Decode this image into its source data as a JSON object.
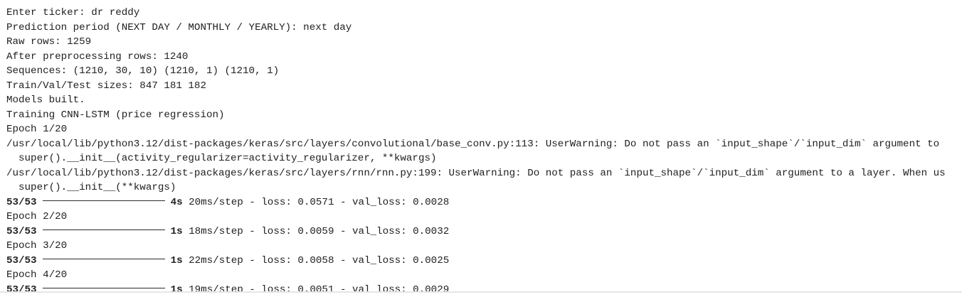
{
  "console": {
    "lines": [
      {
        "text": "Enter ticker: dr reddy"
      },
      {
        "text": "Prediction period (NEXT DAY / MONTHLY / YEARLY): next day"
      },
      {
        "text": "Raw rows: 1259"
      },
      {
        "text": "After preprocessing rows: 1240"
      },
      {
        "text": "Sequences: (1210, 30, 10) (1210, 1) (1210, 1)"
      },
      {
        "text": "Train/Val/Test sizes: 847 181 182"
      },
      {
        "text": "Models built."
      },
      {
        "text": "Training CNN-LSTM (price regression)"
      },
      {
        "text": "Epoch 1/20"
      },
      {
        "text": "/usr/local/lib/python3.12/dist-packages/keras/src/layers/convolutional/base_conv.py:113: UserWarning: Do not pass an `input_shape`/`input_dim` argument to"
      },
      {
        "text": "  super().__init__(activity_regularizer=activity_regularizer, **kwargs)"
      },
      {
        "text": "/usr/local/lib/python3.12/dist-packages/keras/src/layers/rnn/rnn.py:199: UserWarning: Do not pass an `input_shape`/`input_dim` argument to a layer. When us"
      },
      {
        "text": "  super().__init__(**kwargs)"
      },
      {
        "progress": {
          "steps": "53/53",
          "time": "4s",
          "rest": " 20ms/step - loss: 0.0571 - val_loss: 0.0028"
        }
      },
      {
        "text": "Epoch 2/20"
      },
      {
        "progress": {
          "steps": "53/53",
          "time": "1s",
          "rest": " 18ms/step - loss: 0.0059 - val_loss: 0.0032"
        }
      },
      {
        "text": "Epoch 3/20"
      },
      {
        "progress": {
          "steps": "53/53",
          "time": "1s",
          "rest": " 22ms/step - loss: 0.0058 - val_loss: 0.0025"
        }
      },
      {
        "text": "Epoch 4/20"
      },
      {
        "progress": {
          "steps": "53/53",
          "time": "1s",
          "rest": " 19ms/step - loss: 0.0051 - val_loss: 0.0029"
        }
      }
    ]
  }
}
